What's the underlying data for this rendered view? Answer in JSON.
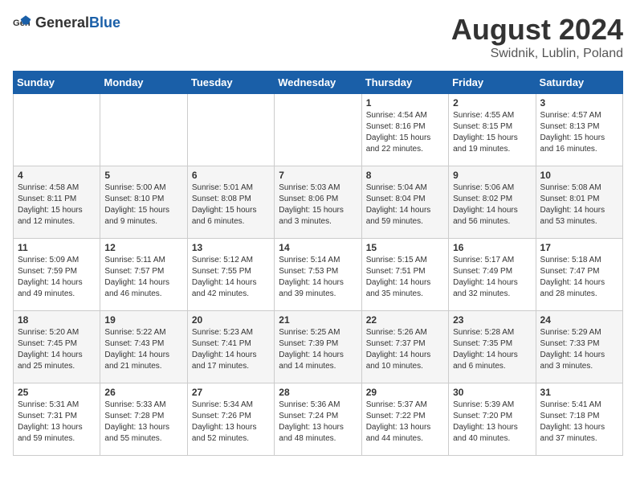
{
  "logo": {
    "general": "General",
    "blue": "Blue"
  },
  "title": "August 2024",
  "subtitle": "Swidnik, Lublin, Poland",
  "weekdays": [
    "Sunday",
    "Monday",
    "Tuesday",
    "Wednesday",
    "Thursday",
    "Friday",
    "Saturday"
  ],
  "weeks": [
    [
      {
        "day": "",
        "info": ""
      },
      {
        "day": "",
        "info": ""
      },
      {
        "day": "",
        "info": ""
      },
      {
        "day": "",
        "info": ""
      },
      {
        "day": "1",
        "info": "Sunrise: 4:54 AM\nSunset: 8:16 PM\nDaylight: 15 hours\nand 22 minutes."
      },
      {
        "day": "2",
        "info": "Sunrise: 4:55 AM\nSunset: 8:15 PM\nDaylight: 15 hours\nand 19 minutes."
      },
      {
        "day": "3",
        "info": "Sunrise: 4:57 AM\nSunset: 8:13 PM\nDaylight: 15 hours\nand 16 minutes."
      }
    ],
    [
      {
        "day": "4",
        "info": "Sunrise: 4:58 AM\nSunset: 8:11 PM\nDaylight: 15 hours\nand 12 minutes."
      },
      {
        "day": "5",
        "info": "Sunrise: 5:00 AM\nSunset: 8:10 PM\nDaylight: 15 hours\nand 9 minutes."
      },
      {
        "day": "6",
        "info": "Sunrise: 5:01 AM\nSunset: 8:08 PM\nDaylight: 15 hours\nand 6 minutes."
      },
      {
        "day": "7",
        "info": "Sunrise: 5:03 AM\nSunset: 8:06 PM\nDaylight: 15 hours\nand 3 minutes."
      },
      {
        "day": "8",
        "info": "Sunrise: 5:04 AM\nSunset: 8:04 PM\nDaylight: 14 hours\nand 59 minutes."
      },
      {
        "day": "9",
        "info": "Sunrise: 5:06 AM\nSunset: 8:02 PM\nDaylight: 14 hours\nand 56 minutes."
      },
      {
        "day": "10",
        "info": "Sunrise: 5:08 AM\nSunset: 8:01 PM\nDaylight: 14 hours\nand 53 minutes."
      }
    ],
    [
      {
        "day": "11",
        "info": "Sunrise: 5:09 AM\nSunset: 7:59 PM\nDaylight: 14 hours\nand 49 minutes."
      },
      {
        "day": "12",
        "info": "Sunrise: 5:11 AM\nSunset: 7:57 PM\nDaylight: 14 hours\nand 46 minutes."
      },
      {
        "day": "13",
        "info": "Sunrise: 5:12 AM\nSunset: 7:55 PM\nDaylight: 14 hours\nand 42 minutes."
      },
      {
        "day": "14",
        "info": "Sunrise: 5:14 AM\nSunset: 7:53 PM\nDaylight: 14 hours\nand 39 minutes."
      },
      {
        "day": "15",
        "info": "Sunrise: 5:15 AM\nSunset: 7:51 PM\nDaylight: 14 hours\nand 35 minutes."
      },
      {
        "day": "16",
        "info": "Sunrise: 5:17 AM\nSunset: 7:49 PM\nDaylight: 14 hours\nand 32 minutes."
      },
      {
        "day": "17",
        "info": "Sunrise: 5:18 AM\nSunset: 7:47 PM\nDaylight: 14 hours\nand 28 minutes."
      }
    ],
    [
      {
        "day": "18",
        "info": "Sunrise: 5:20 AM\nSunset: 7:45 PM\nDaylight: 14 hours\nand 25 minutes."
      },
      {
        "day": "19",
        "info": "Sunrise: 5:22 AM\nSunset: 7:43 PM\nDaylight: 14 hours\nand 21 minutes."
      },
      {
        "day": "20",
        "info": "Sunrise: 5:23 AM\nSunset: 7:41 PM\nDaylight: 14 hours\nand 17 minutes."
      },
      {
        "day": "21",
        "info": "Sunrise: 5:25 AM\nSunset: 7:39 PM\nDaylight: 14 hours\nand 14 minutes."
      },
      {
        "day": "22",
        "info": "Sunrise: 5:26 AM\nSunset: 7:37 PM\nDaylight: 14 hours\nand 10 minutes."
      },
      {
        "day": "23",
        "info": "Sunrise: 5:28 AM\nSunset: 7:35 PM\nDaylight: 14 hours\nand 6 minutes."
      },
      {
        "day": "24",
        "info": "Sunrise: 5:29 AM\nSunset: 7:33 PM\nDaylight: 14 hours\nand 3 minutes."
      }
    ],
    [
      {
        "day": "25",
        "info": "Sunrise: 5:31 AM\nSunset: 7:31 PM\nDaylight: 13 hours\nand 59 minutes."
      },
      {
        "day": "26",
        "info": "Sunrise: 5:33 AM\nSunset: 7:28 PM\nDaylight: 13 hours\nand 55 minutes."
      },
      {
        "day": "27",
        "info": "Sunrise: 5:34 AM\nSunset: 7:26 PM\nDaylight: 13 hours\nand 52 minutes."
      },
      {
        "day": "28",
        "info": "Sunrise: 5:36 AM\nSunset: 7:24 PM\nDaylight: 13 hours\nand 48 minutes."
      },
      {
        "day": "29",
        "info": "Sunrise: 5:37 AM\nSunset: 7:22 PM\nDaylight: 13 hours\nand 44 minutes."
      },
      {
        "day": "30",
        "info": "Sunrise: 5:39 AM\nSunset: 7:20 PM\nDaylight: 13 hours\nand 40 minutes."
      },
      {
        "day": "31",
        "info": "Sunrise: 5:41 AM\nSunset: 7:18 PM\nDaylight: 13 hours\nand 37 minutes."
      }
    ]
  ]
}
